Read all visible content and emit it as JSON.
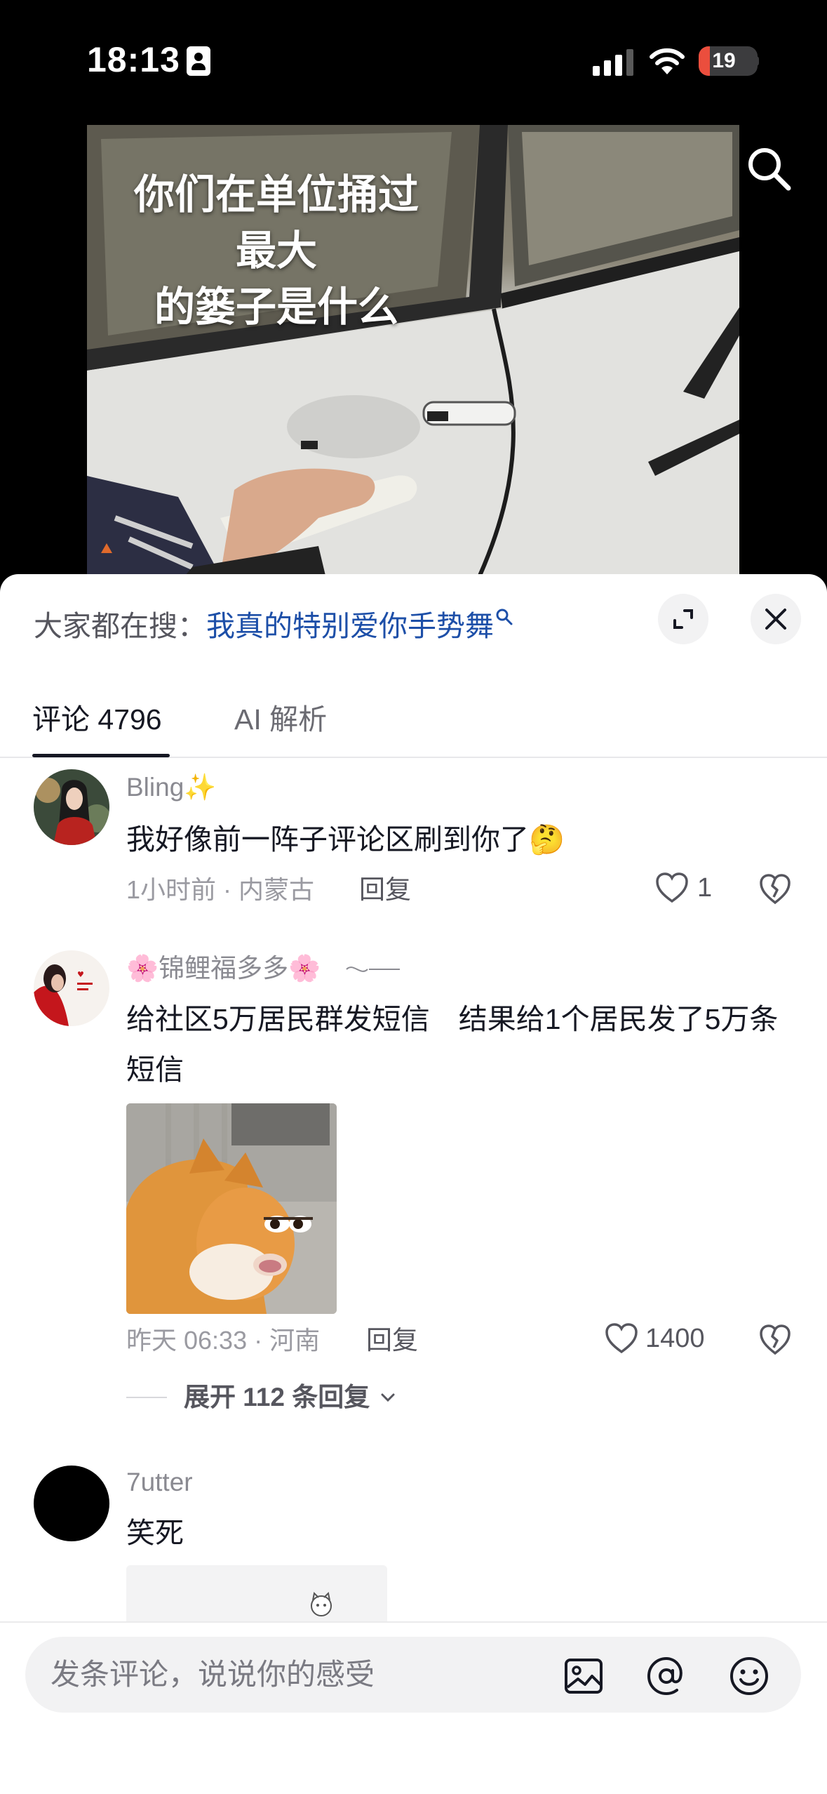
{
  "status_bar": {
    "time": "18:13",
    "battery": "19",
    "battery_level": 0.19
  },
  "video": {
    "caption_line1": "你们在单位捅过最大",
    "caption_line2": "的篓子是什么"
  },
  "hot_search": {
    "prefix": "大家都在搜：",
    "term": "我真的特别爱你手势舞"
  },
  "tabs": [
    {
      "label": "评论 4796"
    },
    {
      "label": "AI 解析"
    }
  ],
  "comments": [
    {
      "username": "Bling✨",
      "text": "我好像前一阵子评论区刷到你了🤔",
      "meta": "1小时前 · 内蒙古",
      "reply_label": "回复",
      "likes": "1"
    },
    {
      "username": "🌸锦鲤福多多🌸",
      "text": "给社区5万居民群发短信　结果给1个居民发了5万条短信",
      "meta": "昨天 06:33 · 河南",
      "reply_label": "回复",
      "likes": "1400",
      "expand_replies": "展开 112 条回复"
    },
    {
      "username": "7utter",
      "text": "笑死"
    }
  ],
  "input": {
    "placeholder": "发条评论，说说你的感受"
  },
  "colors": {
    "accent_link": "#1d4fa8",
    "battery_low": "#eb4e3d"
  },
  "icons": [
    "id-card-icon",
    "signal-icon",
    "wifi-icon",
    "search-icon",
    "expand-icon",
    "close-icon",
    "heart-icon",
    "dislike-icon",
    "chevron-down-icon",
    "image-icon",
    "at-icon",
    "emoji-icon"
  ]
}
